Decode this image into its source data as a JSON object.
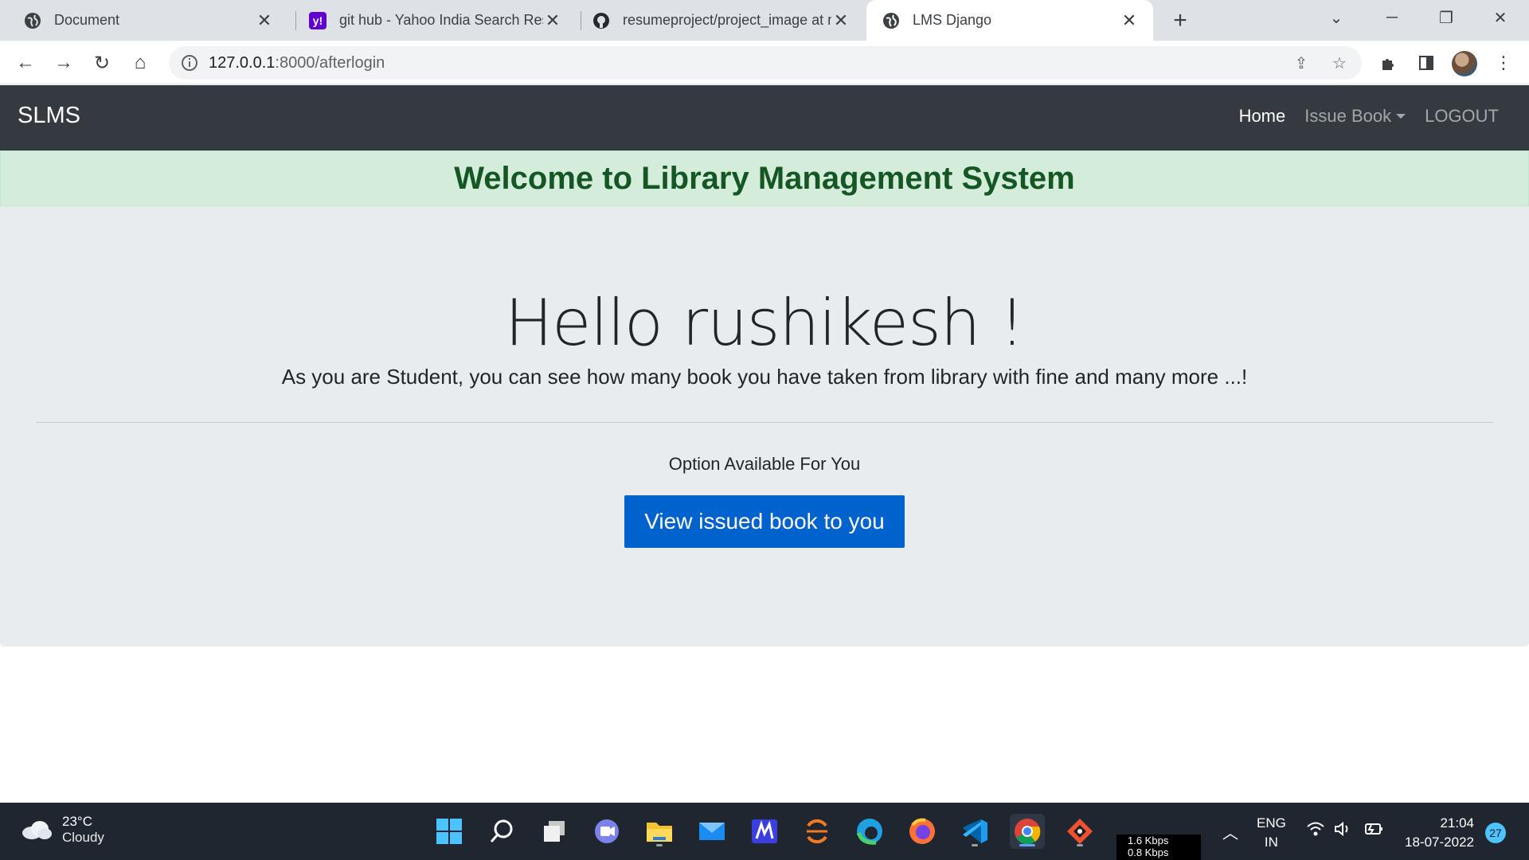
{
  "browser": {
    "tabs": [
      {
        "title": "Document",
        "icon": "globe-icon"
      },
      {
        "title": "git hub - Yahoo India Search Resu",
        "icon": "yahoo-icon"
      },
      {
        "title": "resumeproject/project_image at m",
        "icon": "github-icon"
      },
      {
        "title": "LMS Django",
        "icon": "globe-icon",
        "active": true
      }
    ],
    "url_host": "127.0.0.1",
    "url_rest": ":8000/afterlogin"
  },
  "navbar": {
    "brand": "SLMS",
    "links": {
      "home": "Home",
      "issue_book": "Issue Book",
      "logout": "LOGOUT"
    }
  },
  "alert": {
    "text": "Welcome to Library Management System",
    "color": "#155724",
    "bg": "#d4edda"
  },
  "jumbotron": {
    "greeting": "Hello rushikesh !",
    "lead": "As you are Student, you can see how many book you have taken from library with fine and many more ...!",
    "options_label": "Option Available For You",
    "button_label": "View issued book to you",
    "button_color": "#0062cc"
  },
  "taskbar": {
    "weather_temp": "23°C",
    "weather_desc": "Cloudy",
    "net_up": "1.6 Kbps",
    "net_down": "0.8 Kbps",
    "lang_1": "ENG",
    "lang_2": "IN",
    "time": "21:04",
    "date": "18-07-2022",
    "notifications": "27"
  }
}
